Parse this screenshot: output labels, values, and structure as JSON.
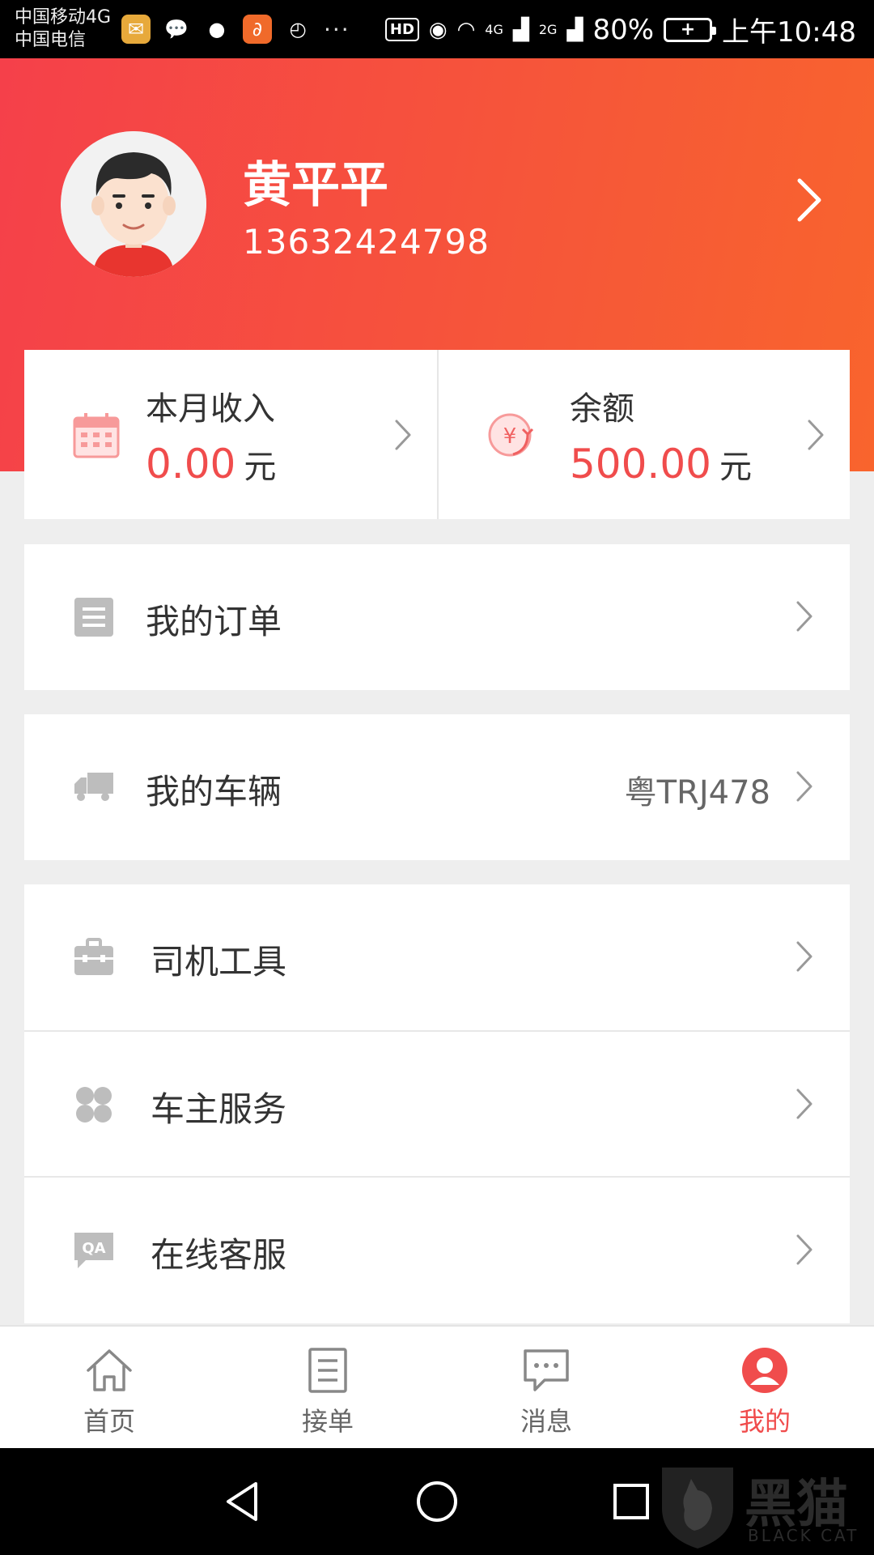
{
  "status_bar": {
    "carrier1": "中国移动4G",
    "carrier2": "中国电信",
    "more": "···",
    "hd": "HD",
    "net1": "4G",
    "net2": "2G",
    "battery": "80%",
    "time": "上午10:48"
  },
  "profile": {
    "name": "黄平平",
    "phone": "13632424798"
  },
  "stats": {
    "income_label": "本月收入",
    "income_value": "0.00",
    "income_unit": "元",
    "balance_label": "余额",
    "balance_value": "500.00",
    "balance_unit": "元"
  },
  "menu": {
    "orders": "我的订单",
    "vehicle": "我的车辆",
    "vehicle_plate": "粤TRJ478",
    "tools": "司机工具",
    "services": "车主服务",
    "support": "在线客服"
  },
  "bottom_nav": {
    "home": "首页",
    "orders": "接单",
    "messages": "消息",
    "mine": "我的"
  },
  "watermark": {
    "text": "黑猫",
    "sub": "BLACK CAT"
  },
  "colors": {
    "accent": "#f04c4c",
    "header_start": "#f5404a",
    "header_end": "#f9642d"
  }
}
